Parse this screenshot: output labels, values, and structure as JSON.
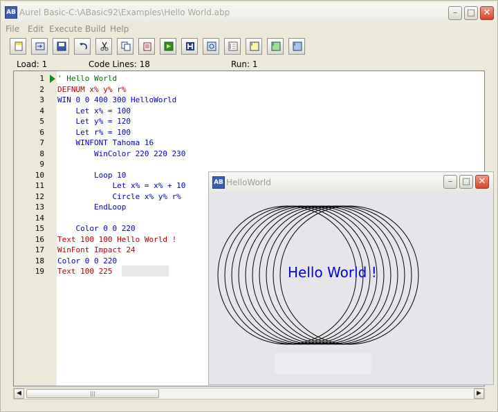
{
  "window": {
    "title": "Aurel Basic-C:\\ABasic92\\Examples\\Hello World.abp",
    "icon": "ab-app-icon",
    "minimize_glyph": "–",
    "maximize_glyph": "□",
    "close_glyph": "✕"
  },
  "menu": [
    "File",
    "Edit",
    "Execute",
    "Build",
    "Help"
  ],
  "toolbar": [
    {
      "name": "new-file-icon"
    },
    {
      "name": "open-file-icon"
    },
    {
      "name": "save-icon"
    },
    {
      "name": "undo-icon"
    },
    {
      "name": "cut-icon"
    },
    {
      "name": "copy-icon"
    },
    {
      "name": "paste-icon"
    },
    {
      "name": "run-icon"
    },
    {
      "name": "help-icon"
    },
    {
      "name": "at-icon"
    },
    {
      "name": "line-numbers-icon"
    },
    {
      "name": "note-yellow-icon"
    },
    {
      "name": "note-green-icon"
    },
    {
      "name": "note-blue-icon"
    }
  ],
  "status": {
    "load": "Load: 1",
    "code_lines": "Code Lines: 18",
    "run": "Run: 1"
  },
  "code_lines": [
    {
      "n": "1",
      "text": "' Hello World"
    },
    {
      "n": "2",
      "text": "DEFNUM x% y% r%"
    },
    {
      "n": "3",
      "text": "WIN 0 0 400 300 HelloWorld"
    },
    {
      "n": "4",
      "text": "    Let x% = 100"
    },
    {
      "n": "5",
      "text": "    Let y% = 120"
    },
    {
      "n": "6",
      "text": "    Let r% = 100"
    },
    {
      "n": "7",
      "text": "    WINFONT Tahoma 16"
    },
    {
      "n": "8",
      "text": "        WinColor 220 220 230"
    },
    {
      "n": "9",
      "text": ""
    },
    {
      "n": "10",
      "text": "        Loop 10"
    },
    {
      "n": "11",
      "text": "            Let x% = x% + 10"
    },
    {
      "n": "12",
      "text": "            Circle x% y% r%"
    },
    {
      "n": "13",
      "text": "        EndLoop"
    },
    {
      "n": "14",
      "text": ""
    },
    {
      "n": "15",
      "text": "    Color 0 0 220"
    },
    {
      "n": "16",
      "text": "Text 100 100 Hello World !"
    },
    {
      "n": "17",
      "text": "WinFont Impact 24"
    },
    {
      "n": "18",
      "text": "Color 0 0 220"
    },
    {
      "n": "19",
      "text": "Text 100 225"
    }
  ],
  "child_window": {
    "title": "HelloWorld",
    "hello_text": "Hello World !",
    "hello_color": "#0000dc",
    "background": "#dcdce6"
  },
  "colors": {
    "keyword_blue": "#0000c8",
    "keyword_red": "#b00000",
    "comment_green": "#007000"
  }
}
